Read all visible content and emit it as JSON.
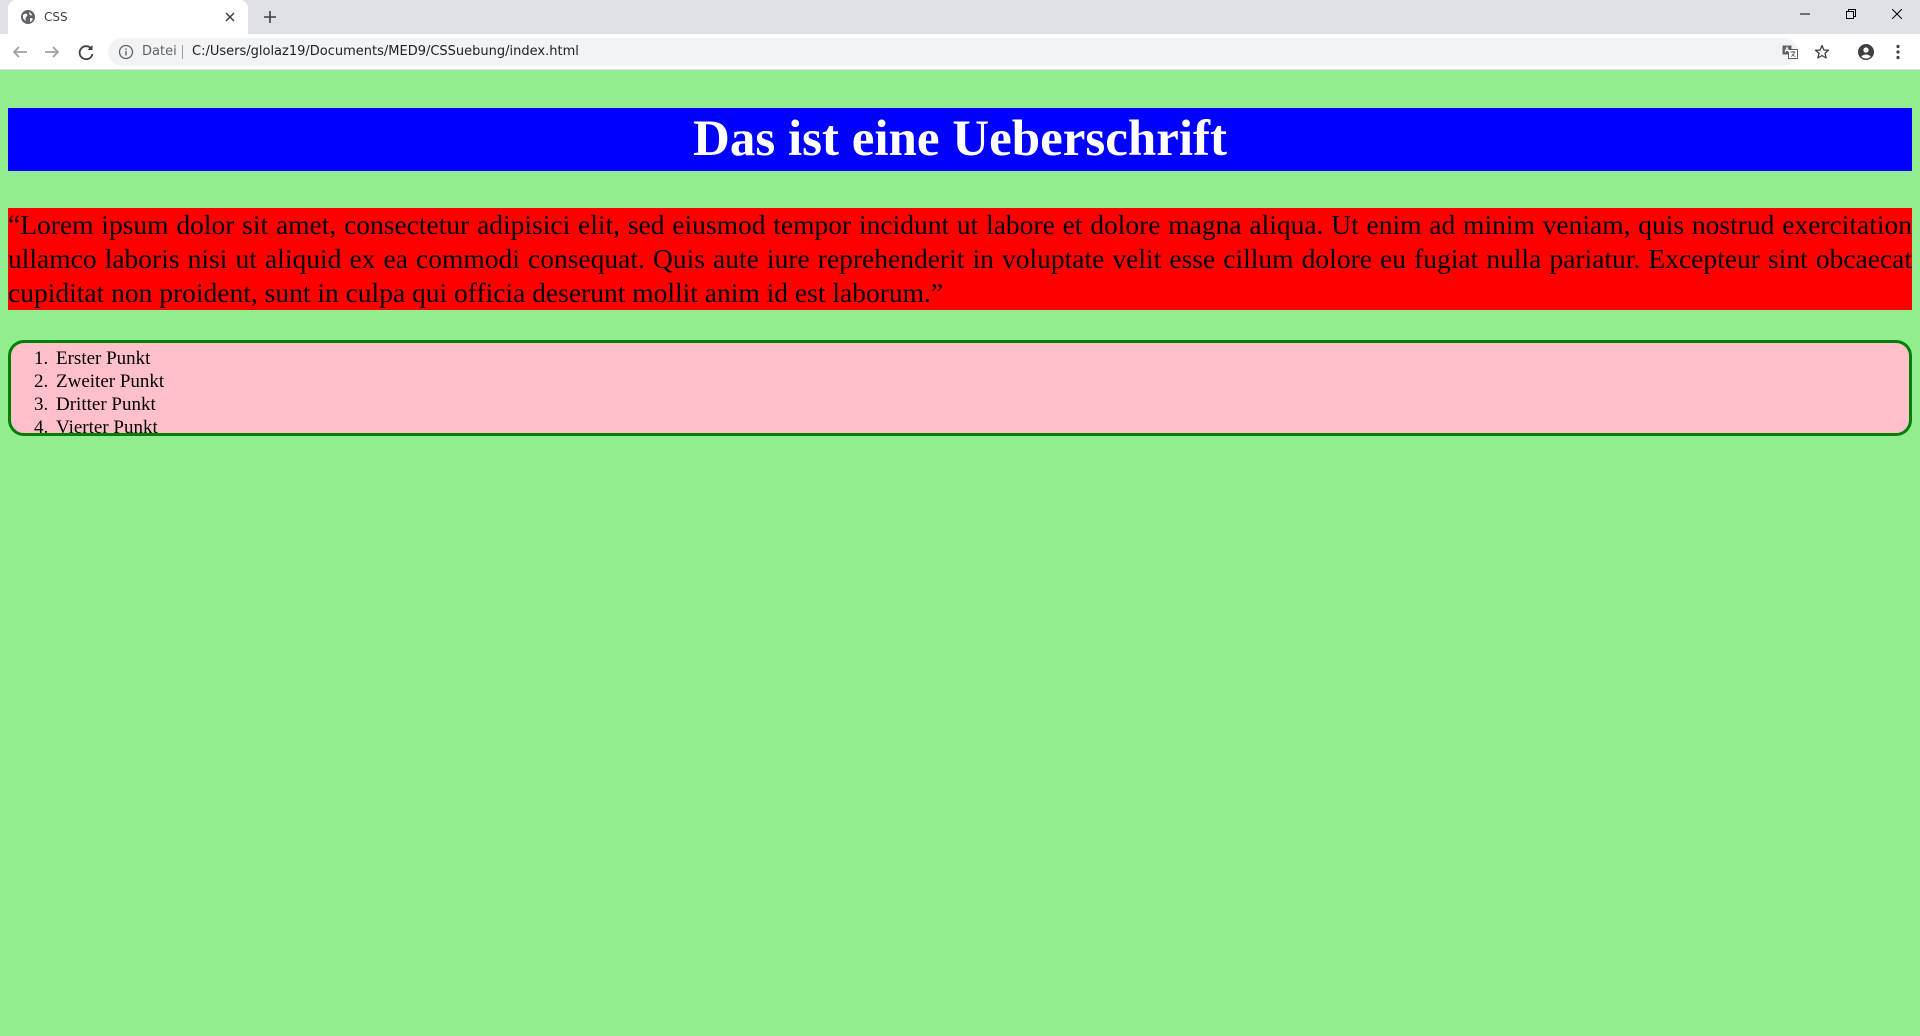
{
  "browser": {
    "tab": {
      "title": "CSS"
    },
    "omnibox": {
      "scheme_label": "Datei",
      "url": "C:/Users/glolaz19/Documents/MED9/CSSuebung/index.html"
    },
    "icons": [
      "globe-icon",
      "close-icon",
      "plus-icon",
      "minimize-icon",
      "restore-icon",
      "window-close-icon",
      "back-arrow-icon",
      "forward-arrow-icon",
      "reload-icon",
      "info-icon",
      "translate-icon",
      "star-icon",
      "profile-icon",
      "more-vert-icon"
    ]
  },
  "page": {
    "heading": "Das ist eine Ueberschrift",
    "paragraph": "“Lorem ipsum dolor sit amet, consectetur adipisici elit, sed eiusmod tempor incidunt ut labore et dolore magna aliqua. Ut enim ad minim veniam, quis nostrud exercitation ullamco laboris nisi ut aliquid ex ea commodi consequat. Quis aute iure reprehenderit in voluptate velit esse cillum dolore eu fugiat nulla pariatur. Excepteur sint obcaecat cupiditat non proident, sunt in culpa qui officia deserunt mollit anim id est laborum.”",
    "list": [
      {
        "label": "Erster Punkt"
      },
      {
        "label": "Zweiter Punkt"
      },
      {
        "label": "Dritter Punkt"
      },
      {
        "label": "Vierter Punkt"
      }
    ]
  },
  "colors": {
    "page_background": "#90ee90",
    "heading_background": "#0000ff",
    "heading_text": "#ffffff",
    "paragraph_background": "#ff0000",
    "list_background": "#ffc0cb",
    "list_border": "#008000"
  }
}
